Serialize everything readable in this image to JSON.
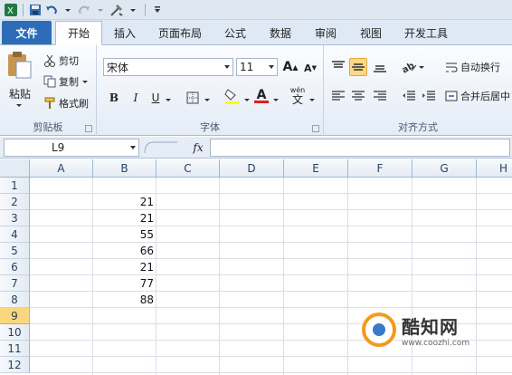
{
  "tabs": {
    "file": "文件",
    "items": [
      "开始",
      "插入",
      "页面布局",
      "公式",
      "数据",
      "审阅",
      "视图",
      "开发工具"
    ]
  },
  "ribbon": {
    "clipboard": {
      "paste": "粘贴",
      "cut": "剪切",
      "copy": "复制",
      "format_painter": "格式刷",
      "label": "剪贴板"
    },
    "font": {
      "font_name": "宋体",
      "font_size": "11",
      "bold": "B",
      "italic": "I",
      "underline": "U",
      "grow": "A",
      "shrink": "A",
      "font_color": "A",
      "wen": "wén",
      "wen_char": "文",
      "label": "字体"
    },
    "alignment": {
      "wrap_text": "自动换行",
      "merge_center": "合并后居中",
      "label": "对齐方式"
    }
  },
  "formula_bar": {
    "name_box": "L9",
    "fx": "fx",
    "value": ""
  },
  "sheet": {
    "columns": [
      "A",
      "B",
      "C",
      "D",
      "E",
      "F",
      "G",
      "H"
    ],
    "rows": [
      "1",
      "2",
      "3",
      "4",
      "5",
      "6",
      "7",
      "8",
      "9",
      "10",
      "11",
      "12"
    ],
    "selected_row": "9",
    "column_b_values": [
      "",
      "21",
      "21",
      "55",
      "66",
      "21",
      "77",
      "88"
    ]
  },
  "watermark": {
    "name": "酷知网",
    "url": "www.coozhi.com"
  },
  "colors": {
    "file_tab": "#2d6db7",
    "selection": "#f9d887",
    "grid_line": "#d9dee6"
  }
}
